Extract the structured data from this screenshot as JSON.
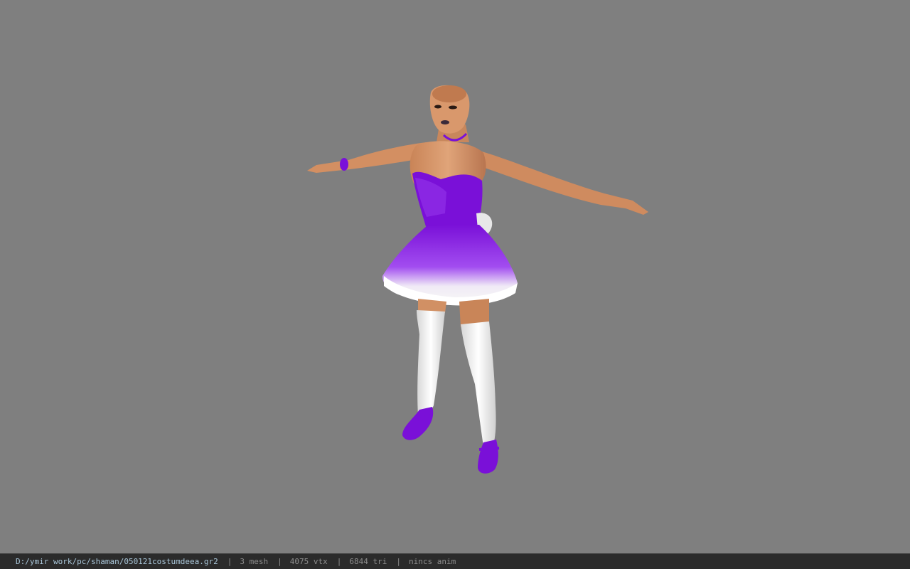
{
  "viewport": {
    "background_color": "#7f7f7f",
    "model": {
      "name": "character-model",
      "colors": {
        "skin": "#d9986c",
        "skin_shadow": "#b06d45",
        "dress": "#7a10d8",
        "dress_light": "#9f3cf0",
        "skirt_trim": "#f4f4f4",
        "stockings": "#eeeeee",
        "shoes": "#7a10d8"
      }
    }
  },
  "status_bar": {
    "file_path": "D:/ymir work/pc/shaman/050121costumdeea.gr2",
    "separator": "|",
    "mesh_count": "3 mesh",
    "vertex_count": "4075 vtx",
    "triangle_count": "6844 tri",
    "anim_status": "nincs anim"
  }
}
